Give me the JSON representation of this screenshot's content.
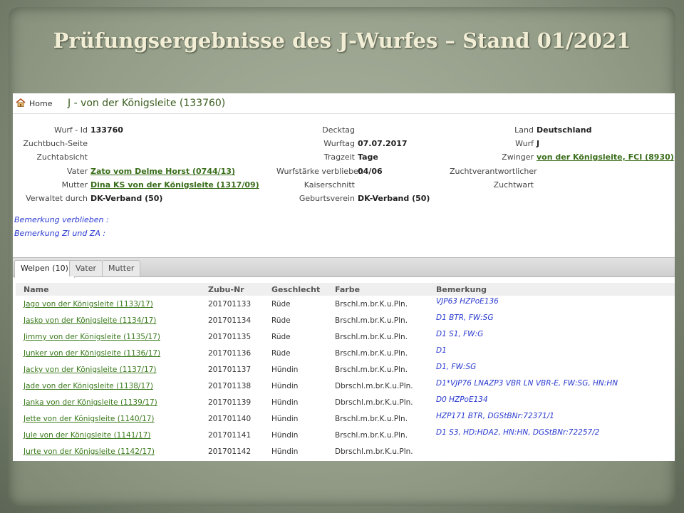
{
  "slide": {
    "title": "Prüfungsergebnisse des J-Wurfes – Stand 01/2021"
  },
  "breadcrumb": {
    "home": "Home",
    "title": "J - von der Königsleite (133760)"
  },
  "info": {
    "wurf_id": {
      "label": "Wurf - Id",
      "value": "133760"
    },
    "zuchtbuch_seite": {
      "label": "Zuchtbuch-Seite",
      "value": ""
    },
    "zuchtabsicht": {
      "label": "Zuchtabsicht",
      "value": ""
    },
    "vater": {
      "label": "Vater",
      "value": "Zato vom Delme Horst (0744/13)"
    },
    "mutter": {
      "label": "Mutter",
      "value": "Dina KS von der Königsleite (1317/09)"
    },
    "verwaltet": {
      "label": "Verwaltet durch",
      "value": "DK-Verband (50)"
    },
    "decktag": {
      "label": "Decktag",
      "value": ""
    },
    "wurftag": {
      "label": "Wurftag",
      "value": "07.07.2017"
    },
    "tragzeit": {
      "label": "Tragzeit",
      "value": "Tage"
    },
    "wurfstaerke": {
      "label": "Wurfstärke verblieben",
      "value": "04/06"
    },
    "kaiserschnitt": {
      "label": "Kaiserschnitt",
      "value": ""
    },
    "geburtsverein": {
      "label": "Geburtsverein",
      "value": "DK-Verband (50)"
    },
    "land": {
      "label": "Land",
      "value": "Deutschland"
    },
    "wurf": {
      "label": "Wurf",
      "value": "J"
    },
    "zwinger": {
      "label": "Zwinger",
      "value": "von der Königsleite, FCI (8930)"
    },
    "zuchtverantwortlicher": {
      "label": "Zuchtverantwortlicher",
      "value": ""
    },
    "zuchtwart": {
      "label": "Zuchtwart",
      "value": ""
    }
  },
  "notes": {
    "verblieben": "Bemerkung verblieben :",
    "zi_za": "Bemerkung ZI und ZA :"
  },
  "tabs": [
    "Welpen (10)",
    "Vater",
    "Mutter"
  ],
  "table": {
    "headers": [
      "Name",
      "Zubu-Nr",
      "Geschlecht",
      "Farbe",
      "Bemerkung"
    ],
    "rows": [
      {
        "name": "Jago von der Königsleite (1133/17)",
        "zubu": "201701133",
        "geschlecht": "Rüde",
        "farbe": "Brschl.m.br.K.u.Pln.",
        "bemerkung": "VJP63 HZPoE136"
      },
      {
        "name": "Jasko von der Königsleite (1134/17)",
        "zubu": "201701134",
        "geschlecht": "Rüde",
        "farbe": "Brschl.m.br.K.u.Pln.",
        "bemerkung": "D1 BTR, FW:SG"
      },
      {
        "name": "Jimmy von der Königsleite (1135/17)",
        "zubu": "201701135",
        "geschlecht": "Rüde",
        "farbe": "Brschl.m.br.K.u.Pln.",
        "bemerkung": "D1 S1, FW:G"
      },
      {
        "name": "Junker von der Königsleite (1136/17)",
        "zubu": "201701136",
        "geschlecht": "Rüde",
        "farbe": "Brschl.m.br.K.u.Pln.",
        "bemerkung": "D1"
      },
      {
        "name": "Jacky von der Königsleite (1137/17)",
        "zubu": "201701137",
        "geschlecht": "Hündin",
        "farbe": "Brschl.m.br.K.u.Pln.",
        "bemerkung": "D1, FW:SG"
      },
      {
        "name": "Jade von der Königsleite (1138/17)",
        "zubu": "201701138",
        "geschlecht": "Hündin",
        "farbe": "Dbrschl.m.br.K.u.Pln.",
        "bemerkung": "D1*VJP76 LNAZP3 VBR LN VBR-E, FW:SG, HN:HN"
      },
      {
        "name": "Janka von der Königsleite (1139/17)",
        "zubu": "201701139",
        "geschlecht": "Hündin",
        "farbe": "Dbrschl.m.br.K.u.Pln.",
        "bemerkung": "D0 HZPoE134"
      },
      {
        "name": "Jette von der Königsleite (1140/17)",
        "zubu": "201701140",
        "geschlecht": "Hündin",
        "farbe": "Brschl.m.br.K.u.Pln.",
        "bemerkung": "HZP171 BTR, DGStBNr:72371/1"
      },
      {
        "name": "Jule von der Königsleite (1141/17)",
        "zubu": "201701141",
        "geschlecht": "Hündin",
        "farbe": "Brschl.m.br.K.u.Pln.",
        "bemerkung": "D1 S3, HD:HDA2, HN:HN, DGStBNr:72257/2"
      },
      {
        "name": "Jurte von der Königsleite (1142/17)",
        "zubu": "201701142",
        "geschlecht": "Hündin",
        "farbe": "Dbrschl.m.br.K.u.Pln.",
        "bemerkung": ""
      }
    ]
  }
}
